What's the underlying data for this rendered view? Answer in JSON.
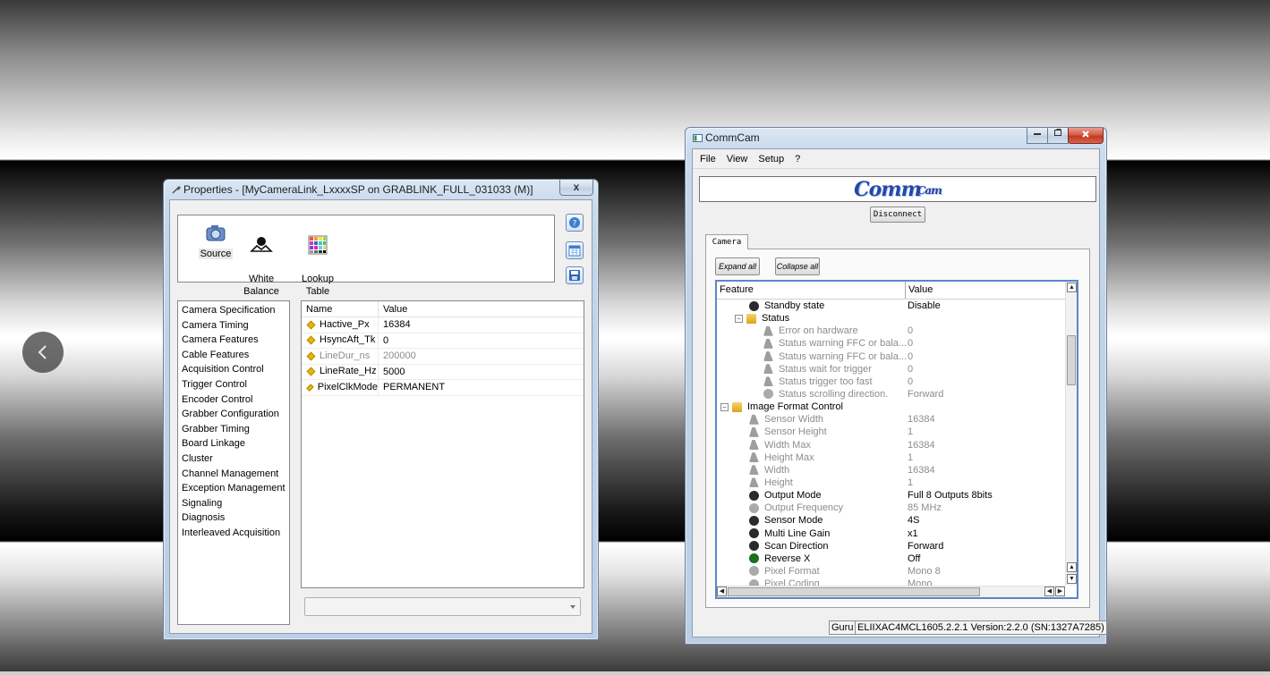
{
  "properties_window": {
    "title": "Properties - [MyCameraLink_LxxxxSP on GRABLINK_FULL_031033 (M)]",
    "close_label": "x",
    "toolbar_items": [
      {
        "label": "Source",
        "icon": "camera-icon"
      },
      {
        "label": "White\nBalance",
        "icon": "white-balance-icon"
      },
      {
        "label": "Lookup\nTable",
        "icon": "lookup-table-icon"
      }
    ],
    "side_buttons": [
      "help-icon",
      "calendar-icon",
      "save-icon"
    ],
    "categories": [
      "Camera Specification",
      "Camera Timing",
      "Camera Features",
      "Cable Features",
      "Acquisition Control",
      "Trigger Control",
      "Encoder Control",
      "Grabber Configuration",
      "Grabber Timing",
      "Board Linkage",
      "Cluster",
      "Channel Management",
      "Exception Management",
      "Signaling",
      "Diagnosis",
      "Interleaved Acquisition"
    ],
    "grid": {
      "headers": [
        "Name",
        "Value"
      ],
      "rows": [
        {
          "name": "Hactive_Px",
          "value": "16384",
          "dim": false
        },
        {
          "name": "HsyncAft_Tk",
          "value": "0",
          "dim": false
        },
        {
          "name": "LineDur_ns",
          "value": "200000",
          "dim": true
        },
        {
          "name": "LineRate_Hz",
          "value": "5000",
          "dim": false
        },
        {
          "name": "PixelClkMode",
          "value": "PERMANENT",
          "dim": false
        }
      ]
    },
    "combo_value": ""
  },
  "commcam_window": {
    "title": "CommCam",
    "menu": [
      "File",
      "View",
      "Setup",
      "?"
    ],
    "logo": {
      "main": "Comm",
      "sub": "Cam"
    },
    "disconnect_label": "Disconnect",
    "tab_label": "Camera",
    "expand_all": "Expand all",
    "collapse_all": "Collapse all",
    "tree_headers": [
      "Feature",
      "Value"
    ],
    "tree_rows": [
      {
        "label": "Standby state",
        "value": "Disable",
        "icon": "e",
        "level": 2,
        "dim": false
      },
      {
        "label": "Status",
        "value": "",
        "icon": "f",
        "level": 1,
        "dim": false,
        "expander": "-"
      },
      {
        "label": "Error on hardware",
        "value": "0",
        "icon": "w",
        "level": 3,
        "dim": true
      },
      {
        "label": "Status warning FFC or bala...",
        "value": "0",
        "icon": "w",
        "level": 3,
        "dim": true
      },
      {
        "label": "Status warning FFC or bala...",
        "value": "0",
        "icon": "w",
        "level": 3,
        "dim": true
      },
      {
        "label": "Status wait for trigger",
        "value": "0",
        "icon": "w",
        "level": 3,
        "dim": true
      },
      {
        "label": "Status trigger too fast",
        "value": "0",
        "icon": "w",
        "level": 3,
        "dim": true
      },
      {
        "label": "Status scrolling direction.",
        "value": "Forward",
        "icon": "eg",
        "level": 3,
        "dim": true
      },
      {
        "label": "Image Format Control",
        "value": "",
        "icon": "f",
        "level": 0,
        "dim": false,
        "expander": "-"
      },
      {
        "label": "Sensor Width",
        "value": "16384",
        "icon": "w",
        "level": 2,
        "dim": true
      },
      {
        "label": "Sensor Height",
        "value": "1",
        "icon": "w",
        "level": 2,
        "dim": true
      },
      {
        "label": "Width Max",
        "value": "16384",
        "icon": "w",
        "level": 2,
        "dim": true
      },
      {
        "label": "Height Max",
        "value": "1",
        "icon": "w",
        "level": 2,
        "dim": true
      },
      {
        "label": "Width",
        "value": "16384",
        "icon": "w",
        "level": 2,
        "dim": true
      },
      {
        "label": "Height",
        "value": "1",
        "icon": "w",
        "level": 2,
        "dim": true
      },
      {
        "label": "Output Mode",
        "value": "Full 8 Outputs 8bits",
        "icon": "e",
        "level": 2,
        "dim": false
      },
      {
        "label": "Output Frequency",
        "value": "85 MHz",
        "icon": "eg",
        "level": 2,
        "dim": true
      },
      {
        "label": "Sensor Mode",
        "value": "4S",
        "icon": "e",
        "level": 2,
        "dim": false
      },
      {
        "label": "Multi Line Gain",
        "value": "x1",
        "icon": "e",
        "level": 2,
        "dim": false
      },
      {
        "label": "Scan Direction",
        "value": "Forward",
        "icon": "e",
        "level": 2,
        "dim": false
      },
      {
        "label": "Reverse X",
        "value": "Off",
        "icon": "grn",
        "level": 2,
        "dim": false
      },
      {
        "label": "Pixel Format",
        "value": "Mono 8",
        "icon": "eg",
        "level": 2,
        "dim": true
      },
      {
        "label": "Pixel Coding",
        "value": "Mono",
        "icon": "eg",
        "level": 2,
        "dim": true
      }
    ],
    "status": {
      "mode": "Guru",
      "info": "ELIIXAC4MCL1605.2.2.1 Version:2.2.0 (SN:1327A7285)"
    }
  }
}
